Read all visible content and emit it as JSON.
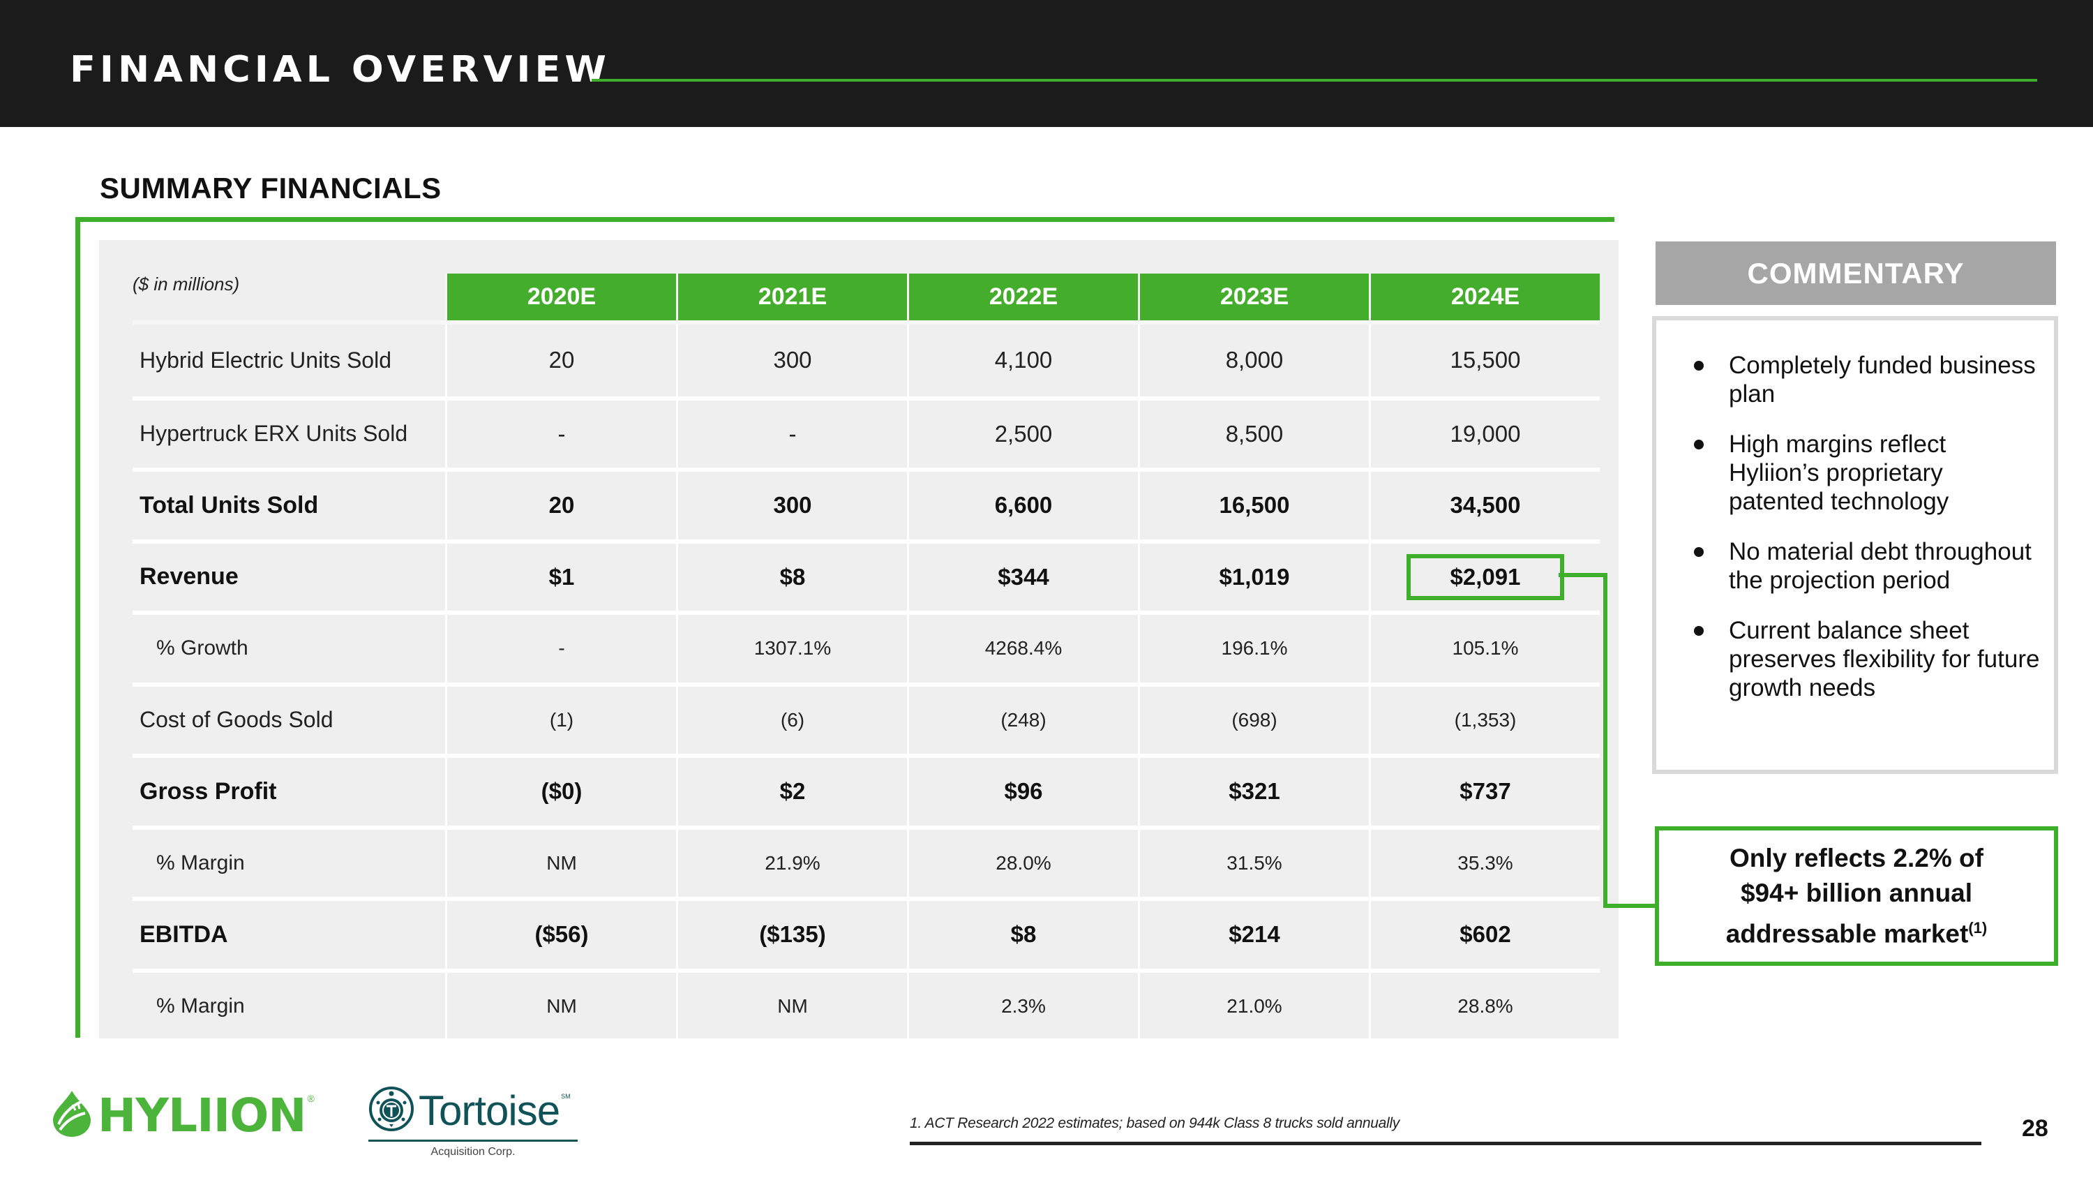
{
  "header": {
    "title": "FINANCIAL OVERVIEW"
  },
  "section_title": "SUMMARY FINANCIALS",
  "table": {
    "units_label": "($ in millions)",
    "columns": [
      "2020E",
      "2021E",
      "2022E",
      "2023E",
      "2024E"
    ],
    "rows": [
      {
        "label": "Hybrid Electric Units Sold",
        "values": [
          "20",
          "300",
          "4,100",
          "8,000",
          "15,500"
        ],
        "style": "normal"
      },
      {
        "label": "Hypertruck ERX Units Sold",
        "values": [
          "-",
          "-",
          "2,500",
          "8,500",
          "19,000"
        ],
        "style": "normal"
      },
      {
        "label": "Total Units Sold",
        "values": [
          "20",
          "300",
          "6,600",
          "16,500",
          "34,500"
        ],
        "style": "bold"
      },
      {
        "label": "Revenue",
        "values": [
          "$1",
          "$8",
          "$344",
          "$1,019",
          "$2,091"
        ],
        "style": "bold",
        "highlight_column": "2024E"
      },
      {
        "label": "% Growth",
        "values": [
          "-",
          "1307.1%",
          "4268.4%",
          "196.1%",
          "105.1%"
        ],
        "style": "indent"
      },
      {
        "label": "Cost of Goods Sold",
        "values": [
          "(1)",
          "(6)",
          "(248)",
          "(698)",
          "(1,353)"
        ],
        "style": "normal"
      },
      {
        "label": "Gross Profit",
        "values": [
          "($0)",
          "$2",
          "$96",
          "$321",
          "$737"
        ],
        "style": "bold"
      },
      {
        "label": "% Margin",
        "values": [
          "NM",
          "21.9%",
          "28.0%",
          "31.5%",
          "35.3%"
        ],
        "style": "indent"
      },
      {
        "label": "EBITDA",
        "values": [
          "($56)",
          "($135)",
          "$8",
          "$214",
          "$602"
        ],
        "style": "bold"
      },
      {
        "label": "% Margin",
        "values": [
          "NM",
          "NM",
          "2.3%",
          "21.0%",
          "28.8%"
        ],
        "style": "indent"
      }
    ]
  },
  "commentary": {
    "title": "COMMENTARY",
    "bullets": [
      "Completely funded business plan",
      "High margins reflect Hyliion’s proprietary patented technology",
      "No material debt throughout the projection period",
      "Current balance sheet preserves flexibility for future growth needs"
    ]
  },
  "callout": {
    "line1": "Only reflects 2.2% of",
    "line2": "$94+ billion annual",
    "line3": "addressable market",
    "footnote_ref": "(1)"
  },
  "footer": {
    "hyliion_logo_text": "HYLIION",
    "hyliion_reg": "®",
    "tortoise_logo_text": "Tortoise",
    "tortoise_sm": "SM",
    "tortoise_subtitle": "Acquisition Corp.",
    "footnote": "1. ACT Research 2022 estimates; based on 944k Class 8 trucks sold annually",
    "page_number": "28"
  },
  "colors": {
    "brand_green": "#3fae2a",
    "header_bg": "#1b1b1b",
    "commentary_head_bg": "#a6a6a6",
    "tortoise_teal": "#0f5257"
  }
}
